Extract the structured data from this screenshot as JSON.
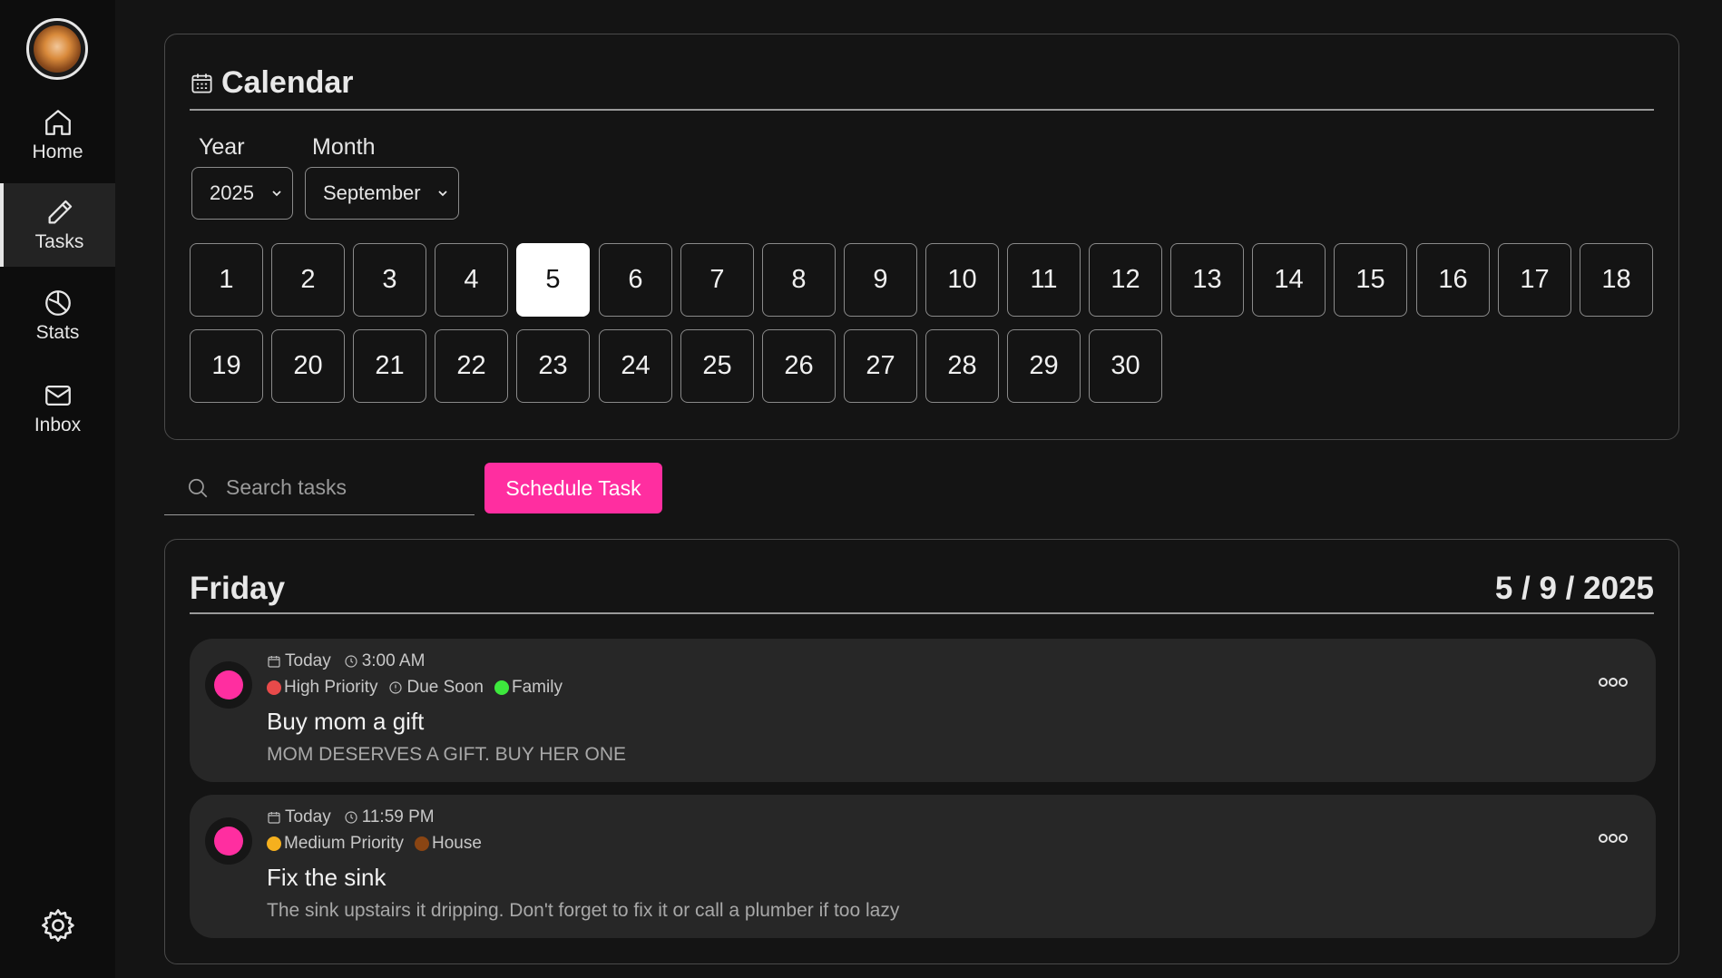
{
  "sidebar": {
    "items": [
      {
        "label": "Home",
        "icon": "home-icon"
      },
      {
        "label": "Tasks",
        "icon": "pencil-icon",
        "active": true
      },
      {
        "label": "Stats",
        "icon": "pie-chart-icon"
      },
      {
        "label": "Inbox",
        "icon": "mail-icon"
      }
    ],
    "settings_icon": "gear-icon"
  },
  "calendar": {
    "title": "Calendar",
    "year_label": "Year",
    "month_label": "Month",
    "year_value": "2025",
    "month_value": "September",
    "days": [
      "1",
      "2",
      "3",
      "4",
      "5",
      "6",
      "7",
      "8",
      "9",
      "10",
      "11",
      "12",
      "13",
      "14",
      "15",
      "16",
      "17",
      "18",
      "19",
      "20",
      "21",
      "22",
      "23",
      "24",
      "25",
      "26",
      "27",
      "28",
      "29",
      "30"
    ],
    "selected_day": "5"
  },
  "search": {
    "placeholder": "Search tasks"
  },
  "schedule_button": "Schedule Task",
  "day_view": {
    "day_name": "Friday",
    "date": "5 / 9 / 2025",
    "tasks": [
      {
        "date": "Today",
        "time": "3:00 AM",
        "priority": "High Priority",
        "priority_color": "#e84a4a",
        "due": "Due Soon",
        "category": "Family",
        "category_color": "#3de83d",
        "title": "Buy mom a gift",
        "description": "MOM DESERVES A GIFT. BUY HER ONE"
      },
      {
        "date": "Today",
        "time": "11:59 PM",
        "priority": "Medium Priority",
        "priority_color": "#f5b01e",
        "category": "House",
        "category_color": "#8a4513",
        "title": "Fix the sink",
        "description": "The sink upstairs it dripping. Don't forget to fix it or call a plumber if too lazy"
      }
    ]
  },
  "colors": {
    "accent": "#ff2ea0",
    "background": "#141414",
    "sidebar": "#0d0d0d"
  }
}
